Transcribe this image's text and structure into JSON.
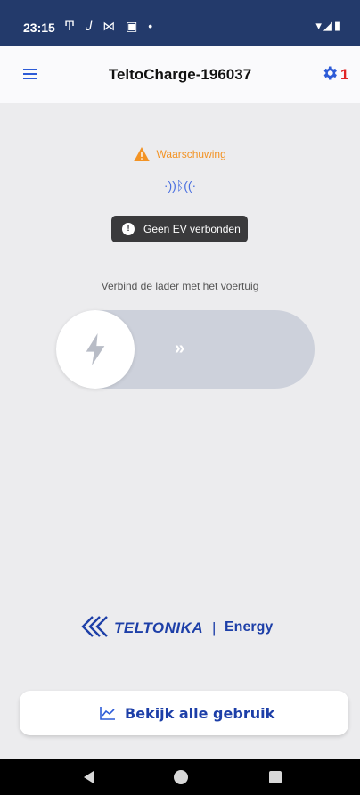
{
  "status_bar": {
    "time": "23:15",
    "icons_left": "Ͳ 𝐽 ⋈ ▣ •",
    "icons_right": "▾◢▮"
  },
  "app_bar": {
    "title": "TeltoCharge-196037",
    "settings_badge": "1",
    "menu_icon": "menu-icon",
    "settings_icon": "gear-icon"
  },
  "status": {
    "warning_label": "Waarschuwing",
    "warning_color": "#f39324",
    "bluetooth_glyph": "·))ᛒ((·",
    "toast_text": "Geen EV verbonden",
    "info_glyph": "!"
  },
  "connect": {
    "hint": "Verbind de lader met het voertuig",
    "slider_arrows": "››"
  },
  "logo": {
    "brand": "TELTONIKA",
    "separator": "|",
    "product": "Energy",
    "brand_color": "#1d3fa8"
  },
  "usage_button": {
    "label": "Bekijk alle gebruik",
    "icon": "line-chart-icon"
  },
  "colors": {
    "status_bar": "#233a6b",
    "accent_blue": "#2d5bd7",
    "badge_red": "#e02424"
  }
}
